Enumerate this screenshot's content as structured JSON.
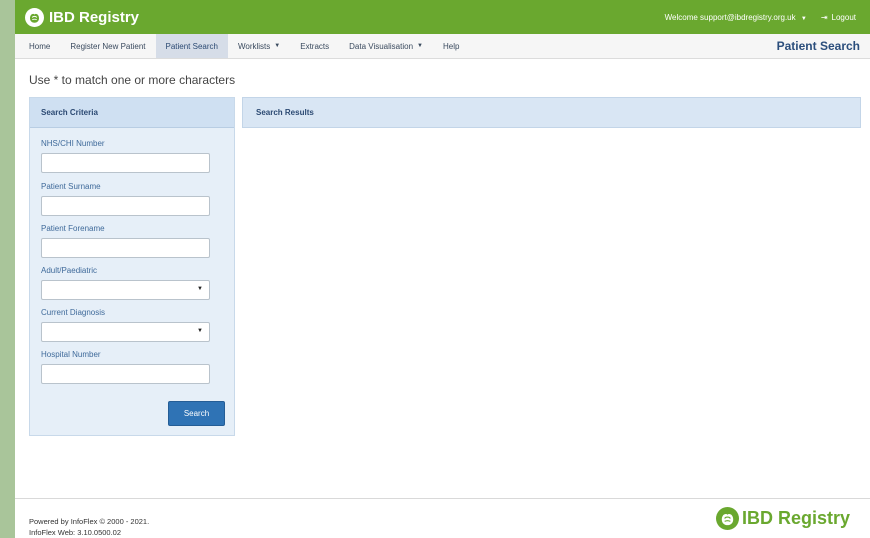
{
  "app": {
    "title": "IBD Registry"
  },
  "topbar": {
    "welcome": "Welcome support@ibdregistry.org.uk",
    "logout": "Logout"
  },
  "nav": {
    "items": [
      {
        "label": "Home"
      },
      {
        "label": "Register New Patient"
      },
      {
        "label": "Patient Search"
      },
      {
        "label": "Worklists"
      },
      {
        "label": "Extracts"
      },
      {
        "label": "Data Visualisation"
      },
      {
        "label": "Help"
      }
    ],
    "page_title": "Patient Search"
  },
  "hint": "Use * to match one or more characters",
  "criteria": {
    "title": "Search Criteria",
    "fields": {
      "nhs": {
        "label": "NHS/CHI Number",
        "value": ""
      },
      "surname": {
        "label": "Patient Surname",
        "value": ""
      },
      "forename": {
        "label": "Patient Forename",
        "value": ""
      },
      "adult_paed": {
        "label": "Adult/Paediatric",
        "value": ""
      },
      "diagnosis": {
        "label": "Current Diagnosis",
        "value": ""
      },
      "hospital": {
        "label": "Hospital Number",
        "value": ""
      }
    },
    "search_button": "Search"
  },
  "results": {
    "title": "Search Results"
  },
  "footer": {
    "powered": "Powered by InfoFlex © 2000 - 2021.",
    "version": "InfoFlex Web: 3.10.0500.02",
    "brand": "IBD Registry"
  },
  "colors": {
    "brand_green": "#6aa82f",
    "primary_blue": "#2f73b5",
    "panel_blue": "#cfe0f2"
  }
}
